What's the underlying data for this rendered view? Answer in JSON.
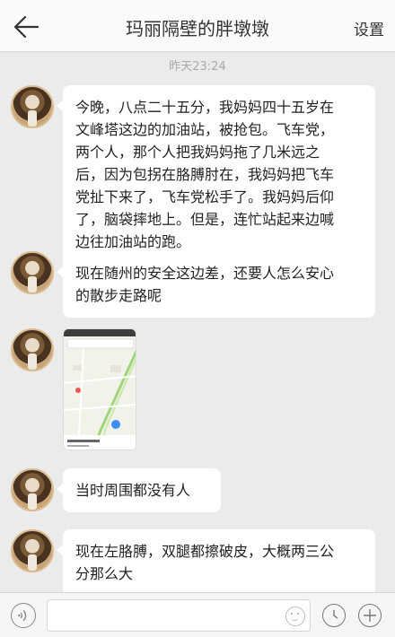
{
  "header": {
    "title": "玛丽隔壁的胖墩墩",
    "settings_label": "设置"
  },
  "timestamp": "昨天23:24",
  "messages": [
    {
      "type": "text",
      "text": "今晚，八点二十五分，我妈妈四十五岁在\n文峰塔这边的加油站，被抢包。飞车党，\n两个人，那个人把我妈妈拖了几米远之\n后，因为包拐在胳膊肘在，我妈妈把飞车\n党扯下来了，飞车党松手了。我妈妈后仰\n了，脑袋摔地上。但是，连忙站起来边喊\n边往加油站的跑。"
    },
    {
      "type": "text",
      "text": "现在随州的安全这边差，还要人怎么安心\n的散步走路呢"
    },
    {
      "type": "image",
      "icon": "map-screenshot"
    },
    {
      "type": "text",
      "text": "当时周围都没有人"
    },
    {
      "type": "text",
      "text": "现在左胳膊，双腿都擦破皮，大概两三公\n分那么大"
    }
  ],
  "footer": {
    "input_value": "",
    "icons": [
      "voice-icon",
      "emoji-icon",
      "clock-icon",
      "plus-icon"
    ]
  }
}
